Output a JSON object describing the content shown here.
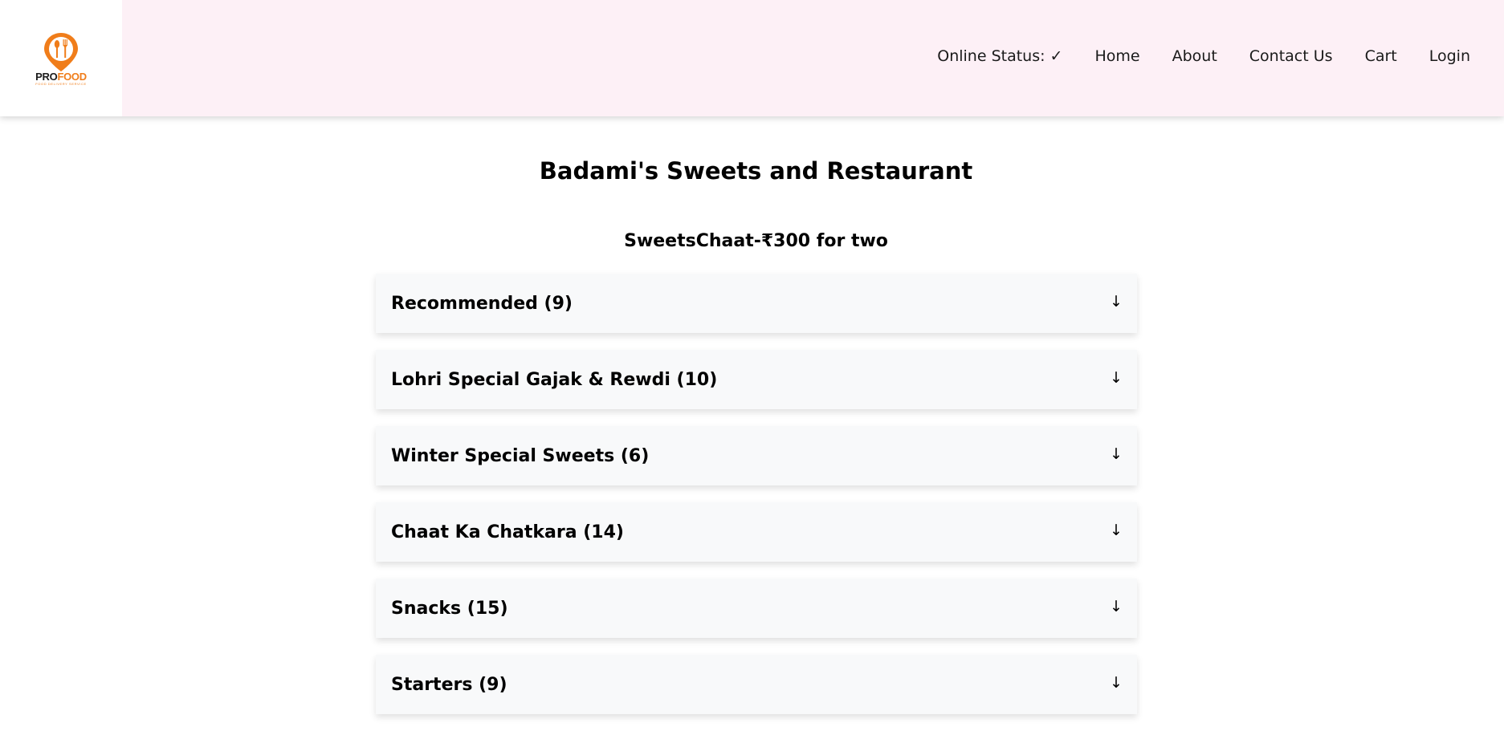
{
  "logo": {
    "icon": "map-pin-fork-spoon-icon",
    "word_pro": "PRO",
    "word_food": "FOOD",
    "tagline": "FOOD DELIVERY SERVICE",
    "color": "#f07d1a"
  },
  "nav": {
    "online_status": "Online Status: ✓",
    "home": "Home",
    "about": "About",
    "contact": "Contact Us",
    "cart": "Cart",
    "login": "Login"
  },
  "restaurant": {
    "name": "Badami's Sweets and Restaurant",
    "info": "SweetsChaat-₹300 for two"
  },
  "categories": [
    {
      "label": "Recommended (9)",
      "arrow": "↓"
    },
    {
      "label": "Lohri Special Gajak & Rewdi (10)",
      "arrow": "↓"
    },
    {
      "label": "Winter Special Sweets (6)",
      "arrow": "↓"
    },
    {
      "label": "Chaat Ka Chatkara (14)",
      "arrow": "↓"
    },
    {
      "label": "Snacks (15)",
      "arrow": "↓"
    },
    {
      "label": "Starters (9)",
      "arrow": "↓"
    }
  ],
  "colors": {
    "header_bg": "#fdf0f6",
    "card_bg": "#f8f9fa",
    "accent": "#f07d1a"
  }
}
